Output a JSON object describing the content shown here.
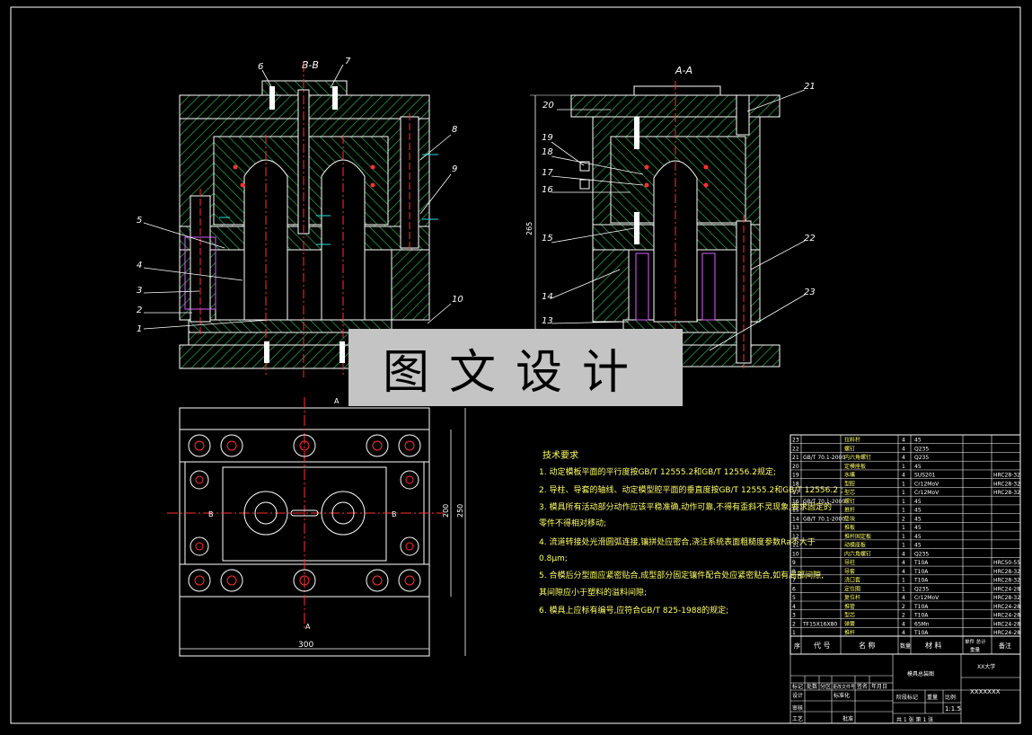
{
  "views": {
    "front_section": "B-B",
    "side_section": "A-A",
    "side_height_dim": "265"
  },
  "front_callouts": [
    "6",
    "7",
    "8",
    "9",
    "5",
    "4",
    "3",
    "2",
    "1",
    "10"
  ],
  "side_callouts": [
    "20",
    "21",
    "19",
    "18",
    "17",
    "16",
    "15",
    "14",
    "13",
    "22",
    "23"
  ],
  "plan_dims": {
    "width": "300",
    "h1": "200",
    "h2": "250",
    "cut_a": "A",
    "cut_b": "B"
  },
  "watermark": "图文设计",
  "tech_requirements": {
    "title": "技术要求",
    "lines": [
      "1. 动定模板平面的平行度按GB/T 12555.2和GB/T 12556.2规定;",
      "2. 导柱、导套的轴线、动定模型腔平面的垂直度按GB/T 12555.2和GB/T 12556.2 ;",
      "3. 模具所有活动部分动作应该平稳准确,动作可靠,不得有歪斜不灵现象,要求固定的",
      "   零件不得相对移动;",
      "4. 流道转接处光滑圆弧连接,镶拼处应密合,浇注系统表面粗糙度参数Ra不大于",
      "   0.8μm;",
      "5. 合模后分型面应紧密贴合,成型部分固定镶件配合处应紧密贴合,如有局部间隙,",
      "   其间隙应小于塑料的溢料间隙;",
      "6. 模具上应标有编号,应符合GB/T 825-1988的规定;"
    ]
  },
  "bom": [
    {
      "no": "23",
      "code": "",
      "name": "拉料杆",
      "qty": "4",
      "mat": "45",
      "note": ""
    },
    {
      "no": "22",
      "code": "",
      "name": "螺钉",
      "qty": "4",
      "mat": "Q235",
      "note": ""
    },
    {
      "no": "21",
      "code": "GB/T 70.1-2000",
      "name": "内六角螺钉",
      "qty": "4",
      "mat": "Q235",
      "note": ""
    },
    {
      "no": "20",
      "code": "",
      "name": "定模座板",
      "qty": "1",
      "mat": "45",
      "note": ""
    },
    {
      "no": "19",
      "code": "",
      "name": "水嘴",
      "qty": "4",
      "mat": "SUS201",
      "note": "HRC28-32"
    },
    {
      "no": "18",
      "code": "",
      "name": "型腔",
      "qty": "1",
      "mat": "Cr12MoV",
      "note": "HRC28-32"
    },
    {
      "no": "17",
      "code": "",
      "name": "型芯",
      "qty": "1",
      "mat": "Cr12MoV",
      "note": "HRC28-32"
    },
    {
      "no": "16",
      "code": "GB/T 70.1-2000",
      "name": "螺钉",
      "qty": "1",
      "mat": "45",
      "note": ""
    },
    {
      "no": "15",
      "code": "",
      "name": "推杆",
      "qty": "1",
      "mat": "45",
      "note": ""
    },
    {
      "no": "14",
      "code": "GB/T 70.1-2000",
      "name": "垫块",
      "qty": "2",
      "mat": "45",
      "note": ""
    },
    {
      "no": "13",
      "code": "",
      "name": "推板",
      "qty": "1",
      "mat": "45",
      "note": ""
    },
    {
      "no": "12",
      "code": "",
      "name": "推杆固定板",
      "qty": "1",
      "mat": "45",
      "note": ""
    },
    {
      "no": "11",
      "code": "",
      "name": "动模座板",
      "qty": "1",
      "mat": "45",
      "note": ""
    },
    {
      "no": "10",
      "code": "",
      "name": "内六角螺钉",
      "qty": "4",
      "mat": "Q235",
      "note": ""
    },
    {
      "no": "9",
      "code": "",
      "name": "导柱",
      "qty": "4",
      "mat": "T10A",
      "note": "HRC50-55"
    },
    {
      "no": "8",
      "code": "",
      "name": "导套",
      "qty": "4",
      "mat": "T10A",
      "note": "HRC28-32"
    },
    {
      "no": "7",
      "code": "",
      "name": "浇口套",
      "qty": "1",
      "mat": "T10A",
      "note": "HRC28-32"
    },
    {
      "no": "6",
      "code": "",
      "name": "定位圈",
      "qty": "1",
      "mat": "Q235",
      "note": "HRC24-28"
    },
    {
      "no": "5",
      "code": "",
      "name": "复位杆",
      "qty": "4",
      "mat": "Cr12MoV",
      "note": "HRC28-32"
    },
    {
      "no": "4",
      "code": "",
      "name": "推管",
      "qty": "2",
      "mat": "T10A",
      "note": "HRC24-28"
    },
    {
      "no": "3",
      "code": "",
      "name": "型芯",
      "qty": "2",
      "mat": "T10A",
      "note": "HRC24-28"
    },
    {
      "no": "2",
      "code": "TF15X16X80",
      "name": "弹簧",
      "qty": "4",
      "mat": "65Mn",
      "note": "HRC24-28"
    },
    {
      "no": "1",
      "code": "",
      "name": "推杆",
      "qty": "4",
      "mat": "T10A",
      "note": "HRC24-28"
    }
  ],
  "bom_header": {
    "no": "序",
    "code": "代 号",
    "name": "名 称",
    "qty": "数量",
    "mat": "材 料",
    "unit_total": "单件 总计",
    "weight": "重量",
    "note": "备注"
  },
  "title_block": {
    "drawing_name": "模具总装图",
    "school": "XX大学",
    "drawing_no": "XXXXXXX",
    "scale": "1:1.5",
    "sheets": "共 1 张  第 1 张",
    "rows": [
      "标记",
      "处数",
      "分区",
      "更改文件号",
      "签名",
      "年月日"
    ],
    "design": "设计",
    "std": "标准化",
    "stage": "阶段标记",
    "weight": "重量",
    "ratio": "比例",
    "review": "审核",
    "craft": "工艺",
    "approve": "批准"
  },
  "colors": {
    "line": "#ffffff",
    "hatch": "#2bb04a",
    "red": "#ff3030",
    "cyan": "#26e0e0",
    "yellow": "#ffff66",
    "magenta": "#d860ff"
  }
}
